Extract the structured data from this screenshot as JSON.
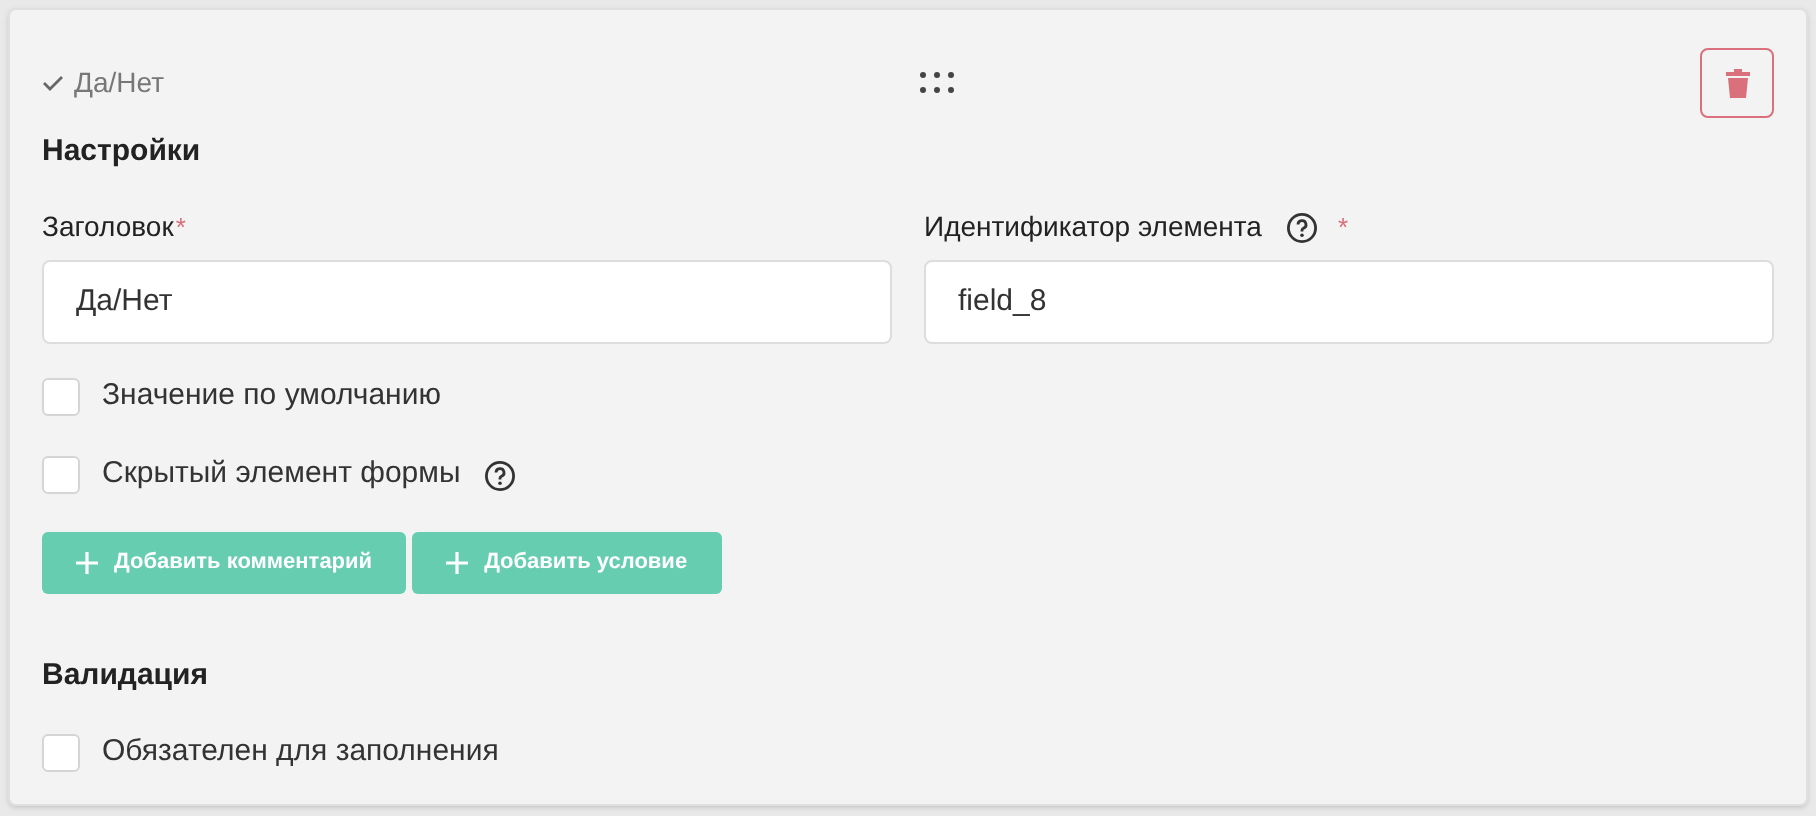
{
  "header": {
    "title": "Да/Нет"
  },
  "settings": {
    "heading": "Настройки",
    "fields": [
      {
        "label": "Заголовок",
        "required_mark": "*",
        "help": false,
        "value": "Да/Нет"
      },
      {
        "label": "Идентификатор элемента",
        "required_mark": "*",
        "help": true,
        "value": "field_8"
      }
    ],
    "checkboxes": [
      {
        "label": "Значение по умолчанию",
        "checked": false,
        "help": false
      },
      {
        "label": "Скрытый элемент формы",
        "checked": false,
        "help": true
      }
    ],
    "buttons": [
      "Добавить комментарий",
      "Добавить условие"
    ]
  },
  "validation": {
    "heading": "Валидация",
    "checkboxes": [
      {
        "label": "Обязателен для заполнения",
        "checked": false,
        "help": false
      }
    ]
  }
}
